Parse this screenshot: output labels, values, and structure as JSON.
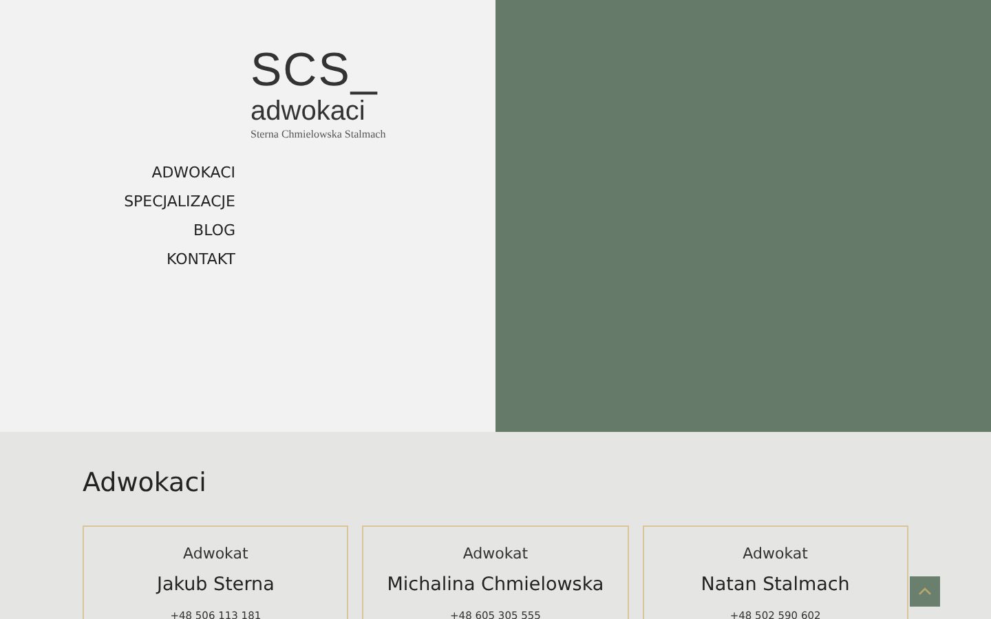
{
  "logo": {
    "mark": "SCS_",
    "name": "adwokaci",
    "tagline": "Sterna Chmielowska Stalmach"
  },
  "nav": [
    {
      "label": "ADWOKACI"
    },
    {
      "label": "SPECJALIZACJE"
    },
    {
      "label": "BLOG"
    },
    {
      "label": "KONTAKT"
    }
  ],
  "section": {
    "title": "Adwokaci"
  },
  "lawyers": [
    {
      "role": "Adwokat",
      "name": "Jakub Sterna",
      "phone": "+48 506 113 181"
    },
    {
      "role": "Adwokat",
      "name": "Michalina Chmielowska",
      "phone": "+48 605 305 555"
    },
    {
      "role": "Adwokat",
      "name": "Natan Stalmach",
      "phone": "+48 502 590 602"
    }
  ]
}
